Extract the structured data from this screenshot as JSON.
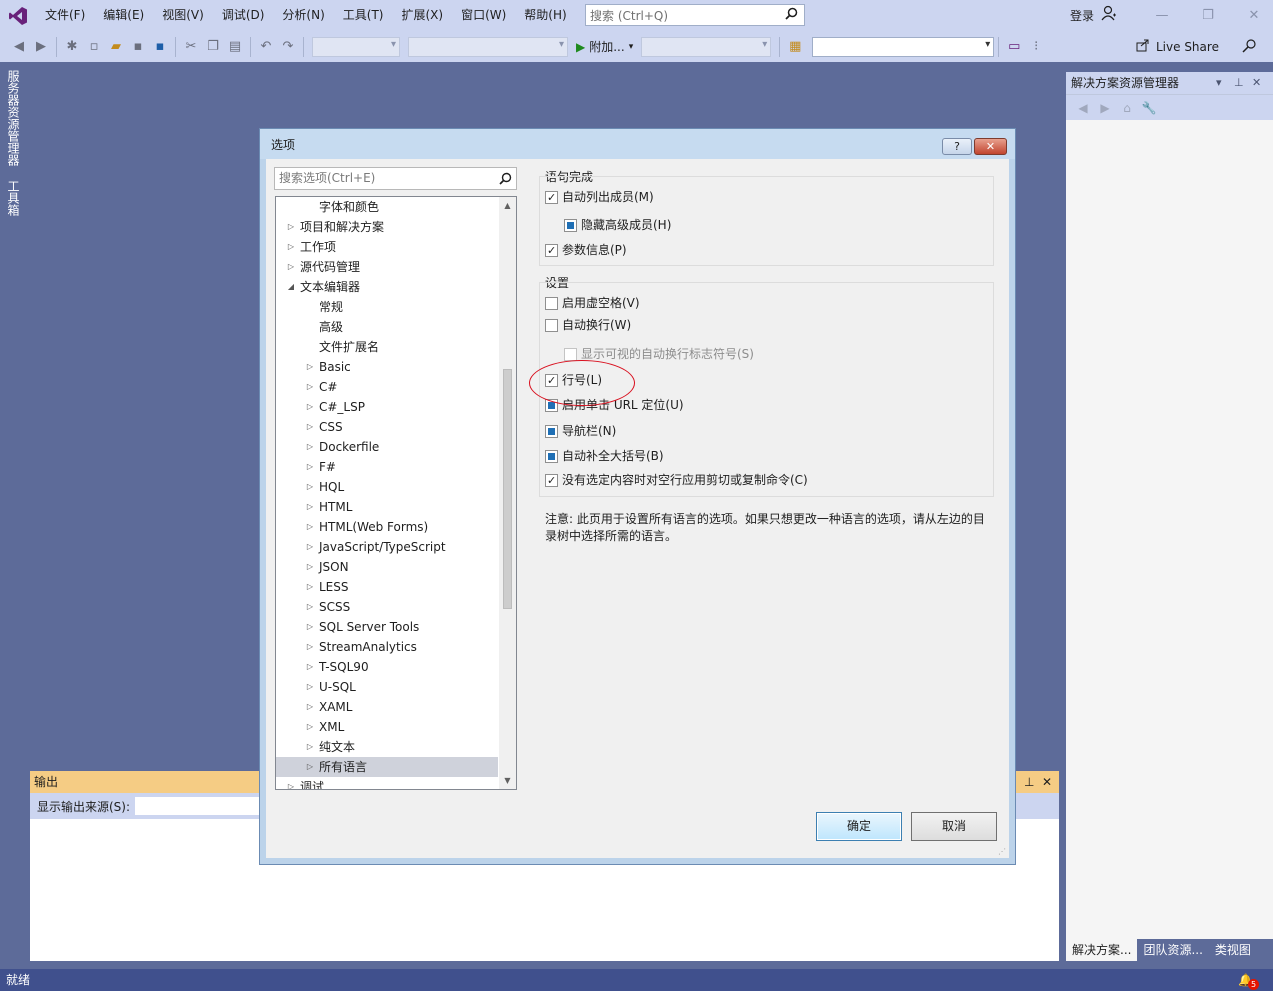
{
  "menubar": {
    "items": [
      "文件(F)",
      "编辑(E)",
      "视图(V)",
      "调试(D)",
      "分析(N)",
      "工具(T)",
      "扩展(X)",
      "窗口(W)",
      "帮助(H)"
    ],
    "search_placeholder": "搜索 (Ctrl+Q)",
    "login": "登录"
  },
  "toolbar": {
    "attach_label": "附加...",
    "live_share": "Live Share"
  },
  "left_tabs": [
    "服务器资源管理器",
    "工具箱"
  ],
  "solution_explorer": {
    "title": "解决方案资源管理器",
    "bottom_tabs": [
      "解决方案...",
      "团队资源...",
      "类视图"
    ]
  },
  "output_panel": {
    "title": "输出",
    "source_label": "显示输出来源(S):"
  },
  "statusbar": {
    "text": "就绪",
    "notification_count": "5"
  },
  "dialog": {
    "title": "选项",
    "help_label": "?",
    "close_label": "✕",
    "search_placeholder": "搜索选项(Ctrl+E)",
    "tree": [
      {
        "label": "字体和颜色",
        "level": 2,
        "arrow": ""
      },
      {
        "label": "项目和解决方案",
        "level": 1,
        "arrow": "▷"
      },
      {
        "label": "工作项",
        "level": 1,
        "arrow": "▷"
      },
      {
        "label": "源代码管理",
        "level": 1,
        "arrow": "▷"
      },
      {
        "label": "文本编辑器",
        "level": 1,
        "arrow": "◢"
      },
      {
        "label": "常规",
        "level": 2,
        "arrow": ""
      },
      {
        "label": "高级",
        "level": 2,
        "arrow": ""
      },
      {
        "label": "文件扩展名",
        "level": 2,
        "arrow": ""
      },
      {
        "label": "Basic",
        "level": 2,
        "arrow": "▷"
      },
      {
        "label": "C#",
        "level": 2,
        "arrow": "▷"
      },
      {
        "label": "C#_LSP",
        "level": 2,
        "arrow": "▷"
      },
      {
        "label": "CSS",
        "level": 2,
        "arrow": "▷"
      },
      {
        "label": "Dockerfile",
        "level": 2,
        "arrow": "▷"
      },
      {
        "label": "F#",
        "level": 2,
        "arrow": "▷"
      },
      {
        "label": "HQL",
        "level": 2,
        "arrow": "▷"
      },
      {
        "label": "HTML",
        "level": 2,
        "arrow": "▷"
      },
      {
        "label": "HTML(Web Forms)",
        "level": 2,
        "arrow": "▷"
      },
      {
        "label": "JavaScript/TypeScript",
        "level": 2,
        "arrow": "▷"
      },
      {
        "label": "JSON",
        "level": 2,
        "arrow": "▷"
      },
      {
        "label": "LESS",
        "level": 2,
        "arrow": "▷"
      },
      {
        "label": "SCSS",
        "level": 2,
        "arrow": "▷"
      },
      {
        "label": "SQL Server Tools",
        "level": 2,
        "arrow": "▷"
      },
      {
        "label": "StreamAnalytics",
        "level": 2,
        "arrow": "▷"
      },
      {
        "label": "T-SQL90",
        "level": 2,
        "arrow": "▷"
      },
      {
        "label": "U-SQL",
        "level": 2,
        "arrow": "▷"
      },
      {
        "label": "XAML",
        "level": 2,
        "arrow": "▷"
      },
      {
        "label": "XML",
        "level": 2,
        "arrow": "▷"
      },
      {
        "label": "纯文本",
        "level": 2,
        "arrow": "▷"
      },
      {
        "label": "所有语言",
        "level": 2,
        "arrow": "▷",
        "selected": true
      },
      {
        "label": "调试",
        "level": 1,
        "arrow": "▷"
      }
    ],
    "statement_completion": {
      "title": "语句完成",
      "options": [
        {
          "label": "自动列出成员(M)",
          "state": "checked"
        },
        {
          "label": "隐藏高级成员(H)",
          "state": "indeterminate"
        },
        {
          "label": "参数信息(P)",
          "state": "checked"
        }
      ]
    },
    "settings": {
      "title": "设置",
      "options": [
        {
          "label": "启用虚空格(V)",
          "state": "unchecked"
        },
        {
          "label": "自动换行(W)",
          "state": "unchecked"
        },
        {
          "label": "显示可视的自动换行标志符号(S)",
          "state": "disabled"
        },
        {
          "label": "行号(L)",
          "state": "checked"
        },
        {
          "label": "启用单击 URL 定位(U)",
          "state": "indeterminate"
        },
        {
          "label": "导航栏(N)",
          "state": "indeterminate"
        },
        {
          "label": "自动补全大括号(B)",
          "state": "indeterminate"
        },
        {
          "label": "没有选定内容时对空行应用剪切或复制命令(C)",
          "state": "checked"
        }
      ]
    },
    "note": "注意: 此页用于设置所有语言的选项。如果只想更改一种语言的选项，请从左边的目录树中选择所需的语言。",
    "ok_label": "确定",
    "cancel_label": "取消"
  }
}
